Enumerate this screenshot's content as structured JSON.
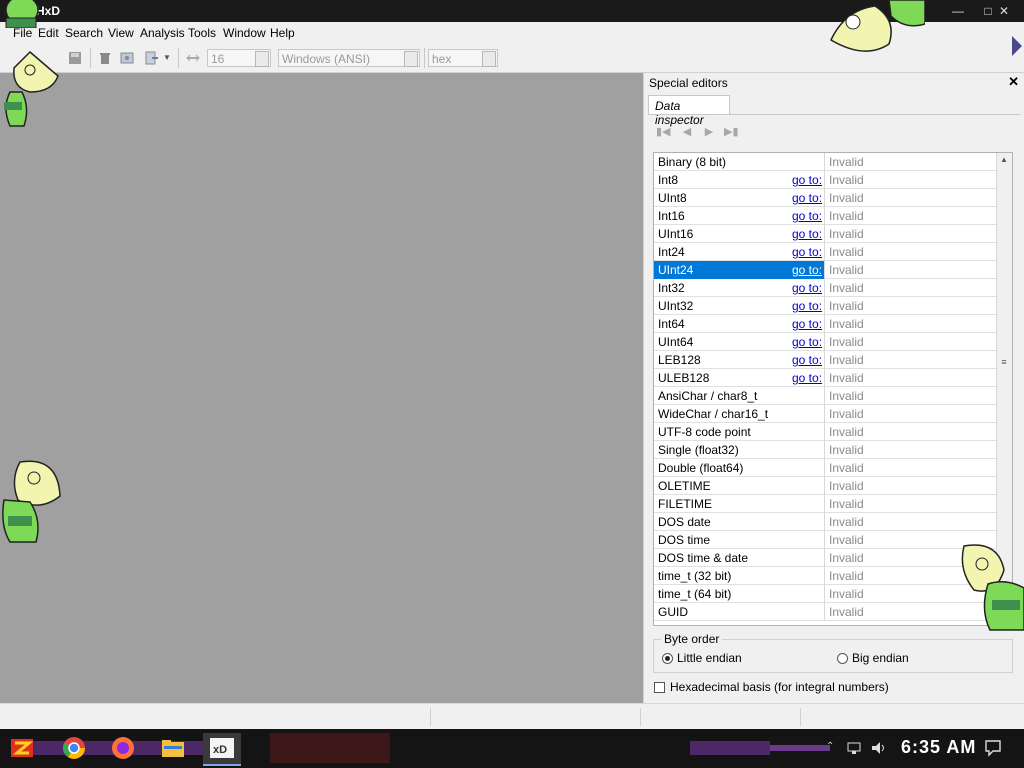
{
  "window": {
    "title": "HxD"
  },
  "menu": [
    "File",
    "Edit",
    "Search",
    "View",
    "Analysis",
    "Tools",
    "Window",
    "Help"
  ],
  "toolbar": {
    "bytes_per_row": "16",
    "charset": "Windows (ANSI)",
    "offset_base": "hex"
  },
  "panel": {
    "title": "Special editors",
    "tab": "Data inspector",
    "rows": [
      {
        "name": "Binary (8 bit)",
        "goto": "",
        "value": "Invalid"
      },
      {
        "name": "Int8",
        "goto": "go to:",
        "value": "Invalid"
      },
      {
        "name": "UInt8",
        "goto": "go to:",
        "value": "Invalid"
      },
      {
        "name": "Int16",
        "goto": "go to:",
        "value": "Invalid"
      },
      {
        "name": "UInt16",
        "goto": "go to:",
        "value": "Invalid"
      },
      {
        "name": "Int24",
        "goto": "go to:",
        "value": "Invalid"
      },
      {
        "name": "UInt24",
        "goto": "go to:",
        "value": "Invalid",
        "selected": true
      },
      {
        "name": "Int32",
        "goto": "go to:",
        "value": "Invalid"
      },
      {
        "name": "UInt32",
        "goto": "go to:",
        "value": "Invalid"
      },
      {
        "name": "Int64",
        "goto": "go to:",
        "value": "Invalid"
      },
      {
        "name": "UInt64",
        "goto": "go to:",
        "value": "Invalid"
      },
      {
        "name": "LEB128",
        "goto": "go to:",
        "value": "Invalid"
      },
      {
        "name": "ULEB128",
        "goto": "go to:",
        "value": "Invalid"
      },
      {
        "name": "AnsiChar / char8_t",
        "goto": "",
        "value": "Invalid"
      },
      {
        "name": "WideChar / char16_t",
        "goto": "",
        "value": "Invalid"
      },
      {
        "name": "UTF-8 code point",
        "goto": "",
        "value": "Invalid"
      },
      {
        "name": "Single (float32)",
        "goto": "",
        "value": "Invalid"
      },
      {
        "name": "Double (float64)",
        "goto": "",
        "value": "Invalid"
      },
      {
        "name": "OLETIME",
        "goto": "",
        "value": "Invalid"
      },
      {
        "name": "FILETIME",
        "goto": "",
        "value": "Invalid"
      },
      {
        "name": "DOS date",
        "goto": "",
        "value": "Invalid"
      },
      {
        "name": "DOS time",
        "goto": "",
        "value": "Invalid"
      },
      {
        "name": "DOS time & date",
        "goto": "",
        "value": "Invalid"
      },
      {
        "name": "time_t (32 bit)",
        "goto": "",
        "value": "Invalid"
      },
      {
        "name": "time_t (64 bit)",
        "goto": "",
        "value": "Invalid"
      },
      {
        "name": "GUID",
        "goto": "",
        "value": "Invalid"
      }
    ],
    "byte_order": {
      "legend": "Byte order",
      "little": "Little endian",
      "big": "Big endian",
      "selected": "little"
    },
    "hex_basis_label": "Hexadecimal basis (for integral numbers)",
    "hex_basis_checked": false
  },
  "taskbar": {
    "clock": "6:35 AM"
  },
  "colors": {
    "selection": "#0078d7",
    "link": "#0000cc",
    "workspace": "#a0a0a0",
    "mascot": "#7ed957"
  }
}
